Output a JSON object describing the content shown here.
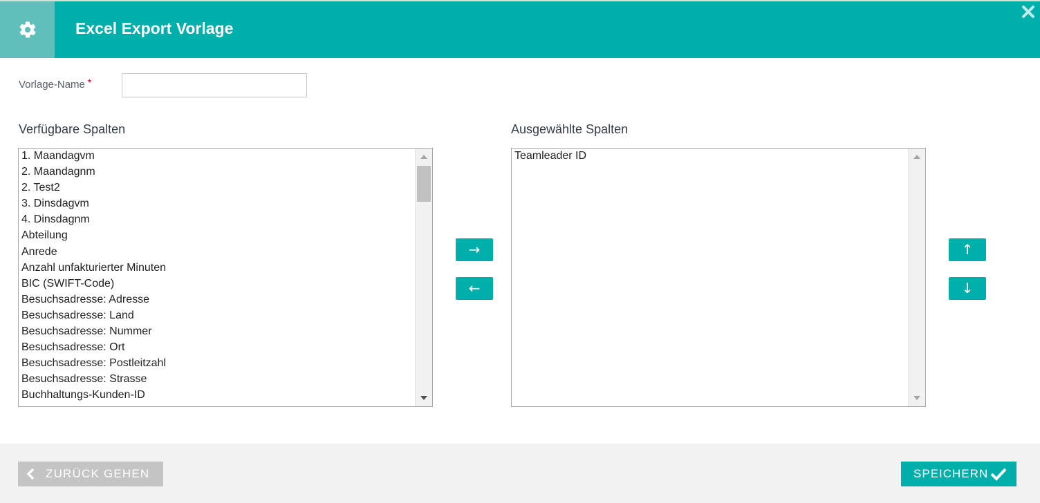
{
  "dialog": {
    "title": "Excel Export Vorlage",
    "settings_icon": "gear-icon",
    "close_icon": "close-icon"
  },
  "form": {
    "name_label": "Vorlage-Name",
    "required_marker": "*",
    "name_value": "",
    "name_placeholder": ""
  },
  "available": {
    "title": "Verfügbare Spalten",
    "items": [
      "1. Maandagvm",
      "2. Maandagnm",
      "2. Test2",
      "3. Dinsdagvm",
      "4. Dinsdagnm",
      "Abteilung",
      "Anrede",
      "Anzahl unfakturierter Minuten",
      "BIC (SWIFT-Code)",
      "Besuchsadresse: Adresse",
      "Besuchsadresse: Land",
      "Besuchsadresse: Nummer",
      "Besuchsadresse: Ort",
      "Besuchsadresse: Postleitzahl",
      "Besuchsadresse: Strasse",
      "Buchhaltungs-Kunden-ID"
    ]
  },
  "selected": {
    "title": "Ausgewählte Spalten",
    "items": [
      "Teamleader ID"
    ]
  },
  "controls": {
    "add_glyph": "→",
    "remove_glyph": "←",
    "up_glyph": "↑",
    "down_glyph": "↓"
  },
  "footer": {
    "back_label": "ZURÜCK GEHEN",
    "save_label": "SPEICHERN"
  },
  "colors": {
    "accent": "#00aeaa",
    "header_icon_bg": "#5fbfba",
    "required": "#e1001a",
    "back_button": "#c4c4c4",
    "footer_bg": "#f2f2f2"
  }
}
